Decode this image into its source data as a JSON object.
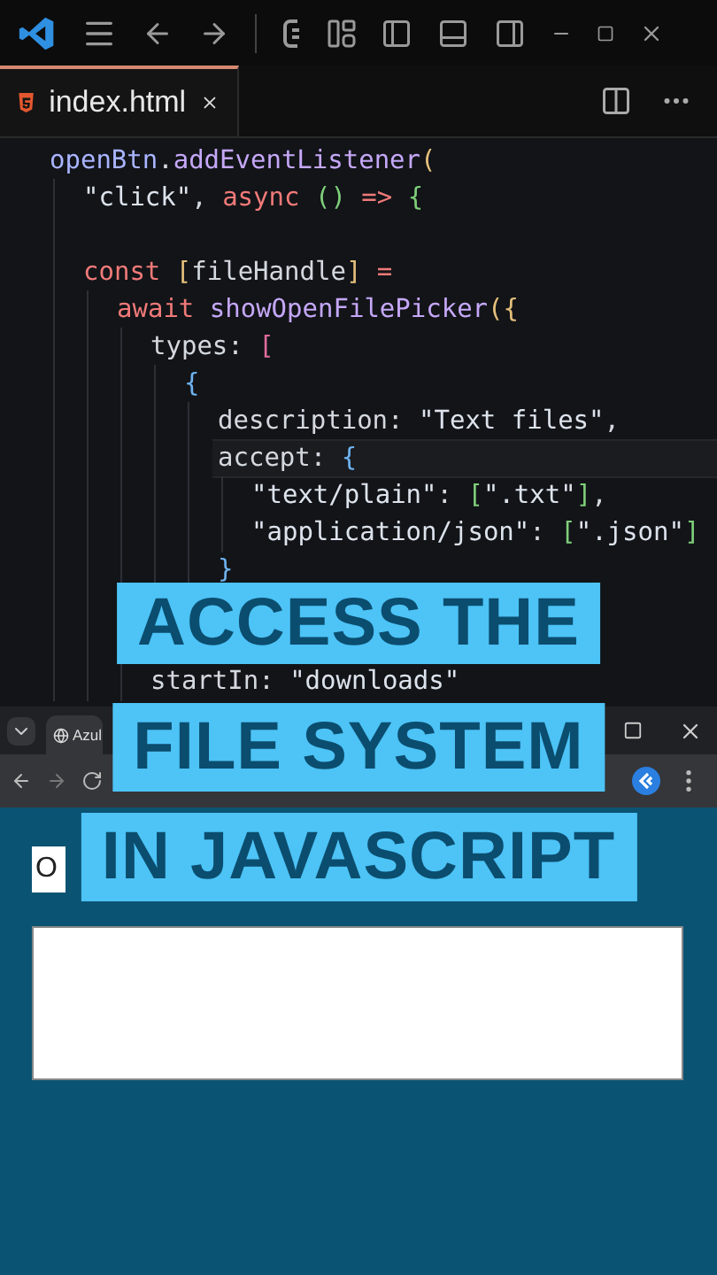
{
  "editor": {
    "tab": {
      "label": "index.html",
      "selected": true
    },
    "lines": [
      {
        "tokens": [
          {
            "text": "openBtn",
            "kind": "var"
          },
          {
            "text": ".",
            "kind": "plain"
          },
          {
            "text": "addEventListener",
            "kind": "func"
          },
          {
            "text": "(",
            "kind": "b1"
          }
        ],
        "children": [
          {
            "tokens": [
              {
                "text": "\"click\"",
                "kind": "string"
              },
              {
                "text": ", ",
                "kind": "plain"
              },
              {
                "text": "async ",
                "kind": "keyword"
              },
              {
                "text": "()",
                "kind": "b4"
              },
              {
                "text": " => ",
                "kind": "keyword"
              },
              {
                "text": "{",
                "kind": "b4"
              }
            ]
          },
          {
            "kind": "blank"
          },
          {
            "tokens": [
              {
                "text": "const ",
                "kind": "keyword"
              },
              {
                "text": "[",
                "kind": "b1"
              },
              {
                "text": "fileHandle",
                "kind": "plain"
              },
              {
                "text": "]",
                "kind": "b1"
              },
              {
                "text": " =",
                "kind": "keyword"
              }
            ],
            "children": [
              {
                "tokens": [
                  {
                    "text": "await ",
                    "kind": "keyword"
                  },
                  {
                    "text": "showOpenFilePicker",
                    "kind": "func"
                  },
                  {
                    "text": "({",
                    "kind": "b1"
                  }
                ],
                "children": [
                  {
                    "tokens": [
                      {
                        "text": "types",
                        "kind": "plain"
                      },
                      {
                        "text": ": ",
                        "kind": "plain"
                      },
                      {
                        "text": "[",
                        "kind": "b2"
                      }
                    ],
                    "children": [
                      {
                        "tokens": [
                          {
                            "text": "{",
                            "kind": "b3"
                          }
                        ],
                        "children": [
                          {
                            "tokens": [
                              {
                                "text": "description",
                                "kind": "plain"
                              },
                              {
                                "text": ": ",
                                "kind": "plain"
                              },
                              {
                                "text": "\"Text files\"",
                                "kind": "string"
                              },
                              {
                                "text": ",",
                                "kind": "plain"
                              }
                            ]
                          },
                          {
                            "current": true,
                            "tokens": [
                              {
                                "text": "accept",
                                "kind": "plain"
                              },
                              {
                                "text": ": ",
                                "kind": "plain"
                              },
                              {
                                "text": "{",
                                "kind": "b3"
                              }
                            ],
                            "children": [
                              {
                                "tokens": [
                                  {
                                    "text": "\"text/plain\"",
                                    "kind": "string"
                                  },
                                  {
                                    "text": ": ",
                                    "kind": "plain"
                                  },
                                  {
                                    "text": "[",
                                    "kind": "b4"
                                  },
                                  {
                                    "text": "\".txt\"",
                                    "kind": "string"
                                  },
                                  {
                                    "text": "]",
                                    "kind": "b4"
                                  },
                                  {
                                    "text": ",",
                                    "kind": "plain"
                                  }
                                ]
                              },
                              {
                                "tokens": [
                                  {
                                    "text": "\"application/json\"",
                                    "kind": "string"
                                  },
                                  {
                                    "text": ": ",
                                    "kind": "plain"
                                  },
                                  {
                                    "text": "[",
                                    "kind": "b4"
                                  },
                                  {
                                    "text": "\".json\"",
                                    "kind": "string"
                                  },
                                  {
                                    "text": "]",
                                    "kind": "b4"
                                  }
                                ]
                              }
                            ]
                          },
                          {
                            "tokens": [
                              {
                                "text": "}",
                                "kind": "b3"
                              }
                            ]
                          }
                        ]
                      }
                    ]
                  },
                  {
                    "kind": "blank"
                  },
                  {
                    "kind": "blank"
                  },
                  {
                    "tokens": [
                      {
                        "text": "startIn",
                        "kind": "plain"
                      },
                      {
                        "text": ": ",
                        "kind": "plain"
                      },
                      {
                        "text": "\"downloads\"",
                        "kind": "string"
                      }
                    ]
                  }
                ]
              }
            ]
          }
        ]
      }
    ]
  },
  "browser": {
    "tab": {
      "label": "Azul",
      "selected": true
    },
    "page": {
      "button": "O"
    }
  },
  "captions": [
    "ACCESS THE",
    "FILE SYSTEM",
    "IN JAVASCRIPT"
  ]
}
